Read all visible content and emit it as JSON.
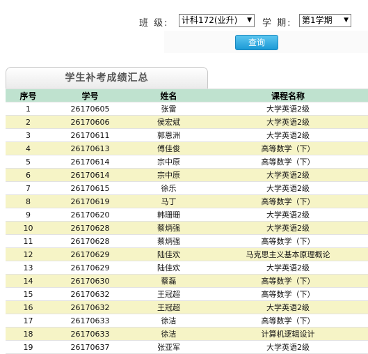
{
  "filters": {
    "class_label": "班 级:",
    "class_value": "计科172(业升)",
    "term_label": "学 期:",
    "term_value": "第1学期",
    "query_button": "查询"
  },
  "tab_title": "学生补考成绩汇总",
  "table": {
    "headers": [
      "序号",
      "学号",
      "姓名",
      "课程名称"
    ],
    "rows": [
      [
        "1",
        "26170605",
        "张雷",
        "大学英语2级"
      ],
      [
        "2",
        "26170606",
        "侯宏斌",
        "大学英语2级"
      ],
      [
        "3",
        "26170611",
        "郭恩洲",
        "大学英语2级"
      ],
      [
        "4",
        "26170613",
        "傅佳俊",
        "高等数学（下）"
      ],
      [
        "5",
        "26170614",
        "宗中原",
        "高等数学（下）"
      ],
      [
        "6",
        "26170614",
        "宗中原",
        "大学英语2级"
      ],
      [
        "7",
        "26170615",
        "徐乐",
        "大学英语2级"
      ],
      [
        "8",
        "26170619",
        "马丁",
        "高等数学（下）"
      ],
      [
        "9",
        "26170620",
        "韩珊珊",
        "大学英语2级"
      ],
      [
        "10",
        "26170628",
        "蔡炳强",
        "大学英语2级"
      ],
      [
        "11",
        "26170628",
        "蔡炳强",
        "高等数学（下）"
      ],
      [
        "12",
        "26170629",
        "陆佳欢",
        "马克思主义基本原理概论"
      ],
      [
        "13",
        "26170629",
        "陆佳欢",
        "大学英语2级"
      ],
      [
        "14",
        "26170630",
        "蔡磊",
        "高等数学（下）"
      ],
      [
        "15",
        "26170632",
        "王冠超",
        "高等数学（下）"
      ],
      [
        "16",
        "26170632",
        "王冠超",
        "大学英语2级"
      ],
      [
        "17",
        "26170633",
        "徐洁",
        "高等数学（下）"
      ],
      [
        "18",
        "26170633",
        "徐洁",
        "计算机逻辑设计"
      ],
      [
        "19",
        "26170637",
        "张亚军",
        "大学英语2级"
      ]
    ]
  }
}
